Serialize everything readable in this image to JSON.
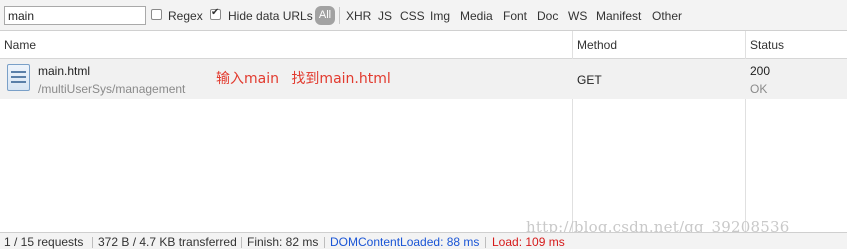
{
  "filter_bar": {
    "search_value": "main",
    "regex_label": "Regex",
    "regex_checked": false,
    "hide_data_urls_label": "Hide data URLs",
    "hide_data_urls_checked": true,
    "all_label": "All",
    "types": [
      "XHR",
      "JS",
      "CSS",
      "Img",
      "Media",
      "Font",
      "Doc",
      "WS",
      "Manifest",
      "Other"
    ]
  },
  "table": {
    "columns": {
      "name": "Name",
      "method": "Method",
      "status": "Status"
    },
    "rows": [
      {
        "name": "main.html",
        "path": "/multiUserSys/management",
        "method": "GET",
        "status_code": "200",
        "status_text": "OK"
      }
    ]
  },
  "annotation": "输入main 找到main.html",
  "watermark": "http://blog.csdn.net/qq_39208536",
  "status_bar": {
    "requests": "1 / 15 requests",
    "transferred": "372 B / 4.7 KB transferred",
    "finish": "Finish: 82 ms",
    "dom_content_loaded": "DOMContentLoaded: 88 ms",
    "load": "Load: 109 ms"
  },
  "colors": {
    "annotation": "#e23a2e",
    "dom_content_loaded": "#1a55d6",
    "load": "#d61a1a"
  }
}
